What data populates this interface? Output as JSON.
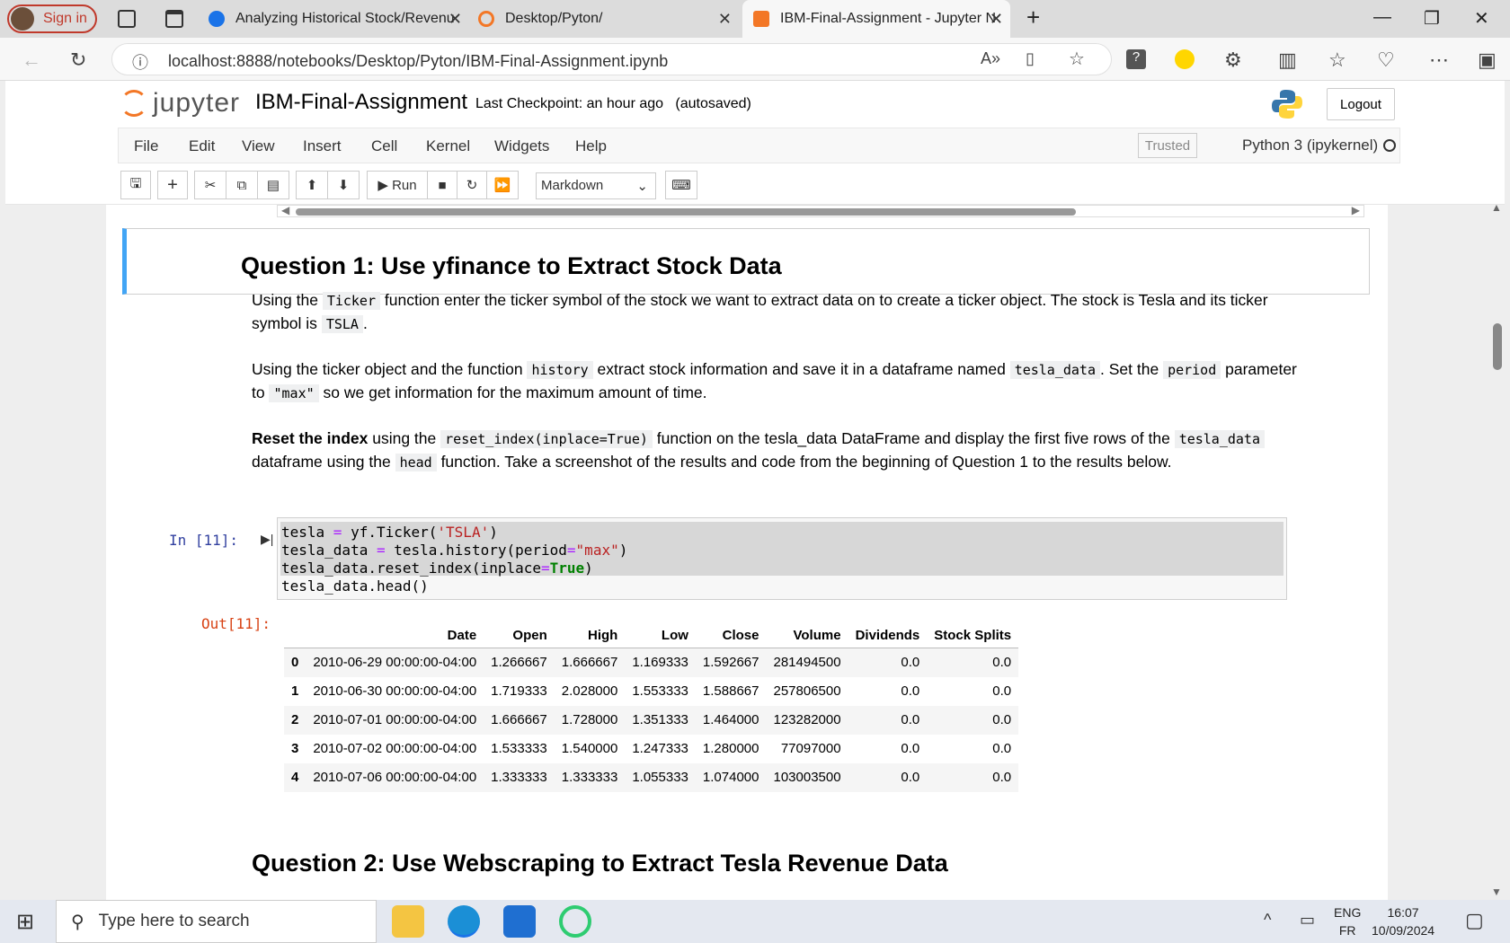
{
  "browser": {
    "signin_label": "Sign in",
    "tabs": [
      {
        "title": "Analyzing Historical Stock/Revenu",
        "color": "#1a73e8"
      },
      {
        "title": "Desktop/Pyton/",
        "color": "#f37726"
      },
      {
        "title": "IBM-Final-Assignment - Jupyter N",
        "color": "#f37726"
      }
    ],
    "url": "localhost:8888/notebooks/Desktop/Pyton/IBM-Final-Assignment.ipynb"
  },
  "jupyter": {
    "logo_text": "jupyter",
    "notebook_name": "IBM-Final-Assignment",
    "checkpoint": "Last Checkpoint: an hour ago",
    "autosaved": "(autosaved)",
    "logout_label": "Logout",
    "menu": [
      "File",
      "Edit",
      "View",
      "Insert",
      "Cell",
      "Kernel",
      "Widgets",
      "Help"
    ],
    "trusted_label": "Trusted",
    "kernel_name": "Python 3 (ipykernel)",
    "run_label": "Run",
    "cell_type": "Markdown"
  },
  "notebook": {
    "q1_heading": "Question 1: Use yfinance to Extract Stock Data",
    "p1": {
      "a": "Using the",
      "code1": "Ticker",
      "b": "function enter the ticker symbol of the stock we want to extract data on to create a ticker object. The stock is Tesla and its ticker symbol is",
      "code2": "TSLA",
      "c": "."
    },
    "p2": {
      "a": "Using the ticker object and the function",
      "code1": "history",
      "b": "extract stock information and save it in a dataframe named",
      "code2": "tesla_data",
      "c": ". Set the",
      "code3": "period",
      "d": "parameter to",
      "code4": "\"max\"",
      "e": "so we get information for the maximum amount of time."
    },
    "p3": {
      "bold": "Reset the index",
      "a": "using the",
      "code1": "reset_index(inplace=True)",
      "b": "function on the tesla_data DataFrame and display the first five rows of the",
      "code2": "tesla_data",
      "c": "dataframe using the",
      "code3": "head",
      "d": "function. Take a screenshot of the results and code from the beginning of Question 1 to the results below."
    },
    "in_prompt": "In [11]:",
    "out_prompt": "Out[11]:",
    "code_lines": [
      "tesla = yf.Ticker('TSLA')",
      "tesla_data = tesla.history(period=\"max\")",
      "tesla_data.reset_index(inplace=True)",
      "tesla_data.head()"
    ],
    "table": {
      "columns": [
        "",
        "Date",
        "Open",
        "High",
        "Low",
        "Close",
        "Volume",
        "Dividends",
        "Stock Splits"
      ],
      "rows": [
        [
          "0",
          "2010-06-29 00:00:00-04:00",
          "1.266667",
          "1.666667",
          "1.169333",
          "1.592667",
          "281494500",
          "0.0",
          "0.0"
        ],
        [
          "1",
          "2010-06-30 00:00:00-04:00",
          "1.719333",
          "2.028000",
          "1.553333",
          "1.588667",
          "257806500",
          "0.0",
          "0.0"
        ],
        [
          "2",
          "2010-07-01 00:00:00-04:00",
          "1.666667",
          "1.728000",
          "1.351333",
          "1.464000",
          "123282000",
          "0.0",
          "0.0"
        ],
        [
          "3",
          "2010-07-02 00:00:00-04:00",
          "1.533333",
          "1.540000",
          "1.247333",
          "1.280000",
          "77097000",
          "0.0",
          "0.0"
        ],
        [
          "4",
          "2010-07-06 00:00:00-04:00",
          "1.333333",
          "1.333333",
          "1.055333",
          "1.074000",
          "103003500",
          "0.0",
          "0.0"
        ]
      ]
    },
    "q2_heading": "Question 2: Use Webscraping to Extract Tesla Revenue Data"
  },
  "taskbar": {
    "search_placeholder": "Type here to search",
    "lang_top": "ENG",
    "lang_bottom": "FR",
    "time": "16:07",
    "date": "10/09/2024"
  }
}
